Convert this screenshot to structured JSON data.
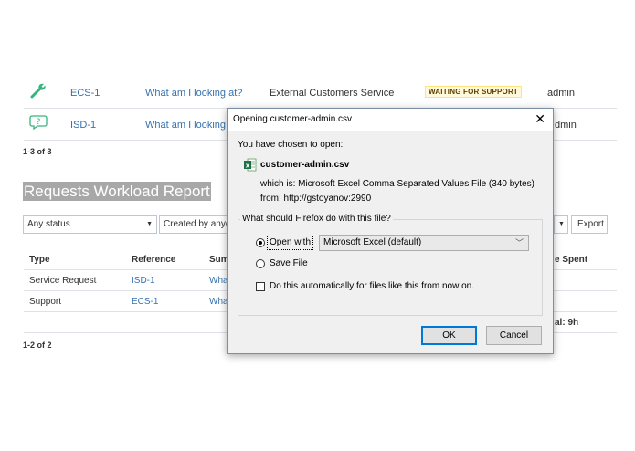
{
  "colors": {
    "link": "#3572b0",
    "lozenge_bg": "#fff8db",
    "lozenge_text": "#594300",
    "dialog_accent": "#0078d7"
  },
  "requests_table": {
    "rows": [
      {
        "icon": "wrench-icon",
        "key": "ECS-1",
        "summary": "What am I looking at?",
        "service": "External Customers Service",
        "status": "WAITING FOR SUPPORT",
        "assignee": "admin"
      },
      {
        "icon": "question-bubble-icon",
        "key": "ISD-1",
        "summary": "What am I looking at?",
        "assignee_visible": "dmin"
      }
    ],
    "count": "1-3 of 3"
  },
  "report": {
    "title": "Requests Workload Report",
    "filter_status": "Any status",
    "filter_created": "Created by anyo",
    "export_label": "Export",
    "headers": {
      "type": "Type",
      "reference": "Reference",
      "summary": "Sum",
      "time_spent": "e Spent"
    },
    "rows": [
      {
        "type": "Service Request",
        "reference": "ISD-1",
        "summary": "Wha"
      },
      {
        "type": "Support",
        "reference": "ECS-1",
        "summary": "Wha"
      }
    ],
    "total": "al: 9h",
    "count": "1-2 of 2"
  },
  "dialog": {
    "title": "Opening customer-admin.csv",
    "intro": "You have chosen to open:",
    "file_icon": "excel-file-icon",
    "filename": "customer-admin.csv",
    "which_is": "which is: Microsoft Excel Comma Separated Values File (340 bytes)",
    "from": "from: http://gstoyanov:2990",
    "question": "What should Firefox do with this file?",
    "open_with_label": "Open with",
    "open_with_value": "Microsoft Excel (default)",
    "save_file_label": "Save File",
    "auto_label": "Do this automatically for files like this from now on.",
    "ok_label": "OK",
    "cancel_label": "Cancel",
    "selected_option": "open_with"
  }
}
